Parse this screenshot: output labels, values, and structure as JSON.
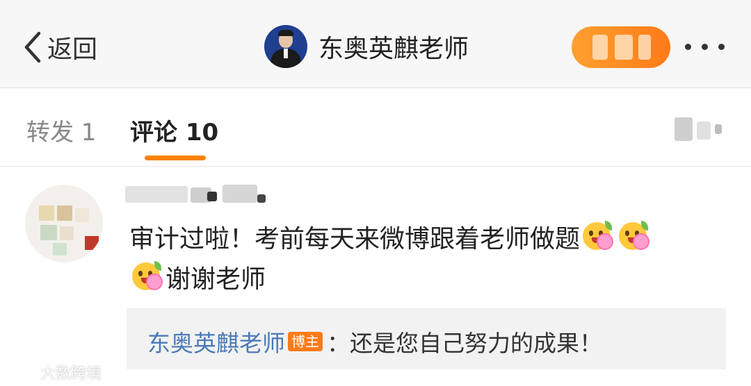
{
  "header": {
    "back_label": "返回",
    "user_name": "东奥英麒老师",
    "icons": {
      "back": "chevron-left-icon",
      "more": "more-dots-icon"
    }
  },
  "tabs": {
    "repost": "转发 1",
    "comment": "评论 10",
    "active": "comment"
  },
  "comment": {
    "text_part1": "审计过啦！考前每天来微博跟着老师做题",
    "text_part2": "谢谢老师",
    "emoji_name": "flower-blush-emoji",
    "reply": {
      "author": "东奥英麒老师",
      "badge": "博主",
      "separator": "：",
      "text": "还是您自己努力的成果！"
    }
  },
  "watermark": {
    "text": "大数跨境"
  },
  "colors": {
    "accent": "#ff8200",
    "link": "#4a7ab8",
    "badge": "#ff7a18",
    "header_bg": "#f7f7f7",
    "reply_bg": "#f2f2f2"
  }
}
